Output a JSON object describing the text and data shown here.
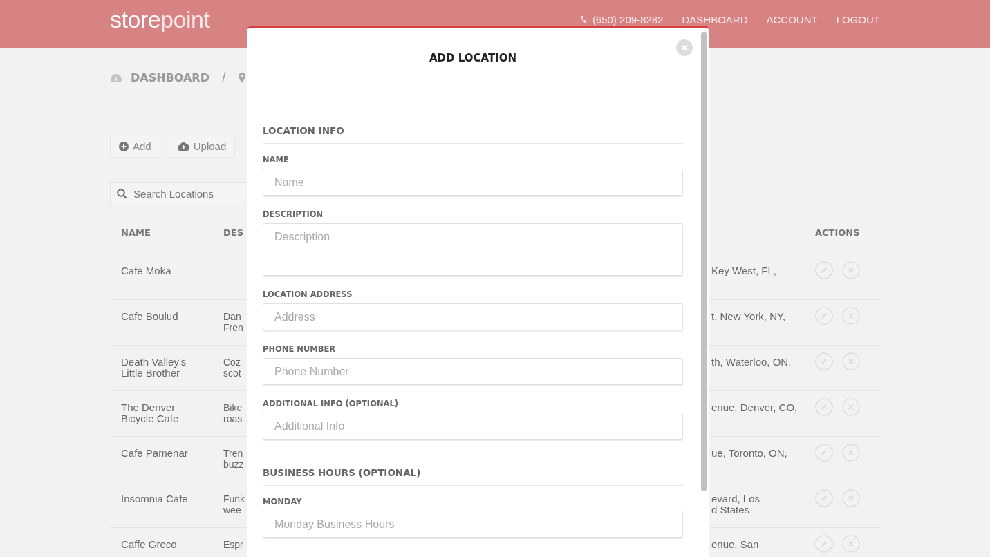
{
  "header": {
    "logo": [
      "store",
      "point"
    ],
    "phone": "(650) 209-8282",
    "nav": [
      "DASHBOARD",
      "ACCOUNT",
      "LOGOUT"
    ]
  },
  "breadcrumb": {
    "label": "DASHBOARD",
    "separator": "/"
  },
  "toolbar": {
    "buttons": [
      {
        "kind": "add",
        "label": "Add"
      },
      {
        "kind": "upload",
        "label": "Upload"
      }
    ]
  },
  "search": {
    "placeholder": "Search Locations"
  },
  "table": {
    "columns": [
      "NAME",
      "DES",
      "ACTIONS"
    ],
    "rows": [
      {
        "name": "Café Moka",
        "description": [],
        "address": [
          "Key West, FL,"
        ]
      },
      {
        "name": "Cafe Boulud",
        "description": [
          "Dan",
          "Fren"
        ],
        "address": [
          "t, New York, NY,"
        ]
      },
      {
        "name": "Death Valley's Little Brother",
        "description": [
          "Coz",
          "scot"
        ],
        "address": [
          "th, Waterloo, ON,"
        ]
      },
      {
        "name": "The Denver Bicycle Cafe",
        "description": [
          "Bike",
          "roas"
        ],
        "address": [
          "enue, Denver, CO,"
        ]
      },
      {
        "name": "Cafe Pamenar",
        "description": [
          "Tren",
          "buzz"
        ],
        "address": [
          "ue, Toronto, ON,"
        ]
      },
      {
        "name": "Insomnia Cafe",
        "description": [
          "Funk",
          "wee"
        ],
        "address": [
          "evard, Los",
          "d States"
        ]
      },
      {
        "name": "Caffe Greco",
        "description": [
          "Espr"
        ],
        "address": [
          "enue, San"
        ]
      }
    ]
  },
  "modal": {
    "title": "ADD LOCATION",
    "sections": [
      {
        "heading": "LOCATION INFO",
        "fields": [
          {
            "label": "NAME",
            "placeholder": "Name",
            "kind": "input"
          },
          {
            "label": "DESCRIPTION",
            "placeholder": "Description",
            "kind": "textarea"
          },
          {
            "label": "LOCATION ADDRESS",
            "placeholder": "Address",
            "kind": "input"
          },
          {
            "label": "PHONE NUMBER",
            "placeholder": "Phone Number",
            "kind": "input"
          },
          {
            "label": "ADDITIONAL INFO (OPTIONAL)",
            "placeholder": "Additional Info",
            "kind": "input"
          }
        ]
      },
      {
        "heading": "BUSINESS HOURS (OPTIONAL)",
        "fields": [
          {
            "label": "MONDAY",
            "placeholder": "Monday Business Hours",
            "kind": "input"
          }
        ]
      }
    ]
  }
}
